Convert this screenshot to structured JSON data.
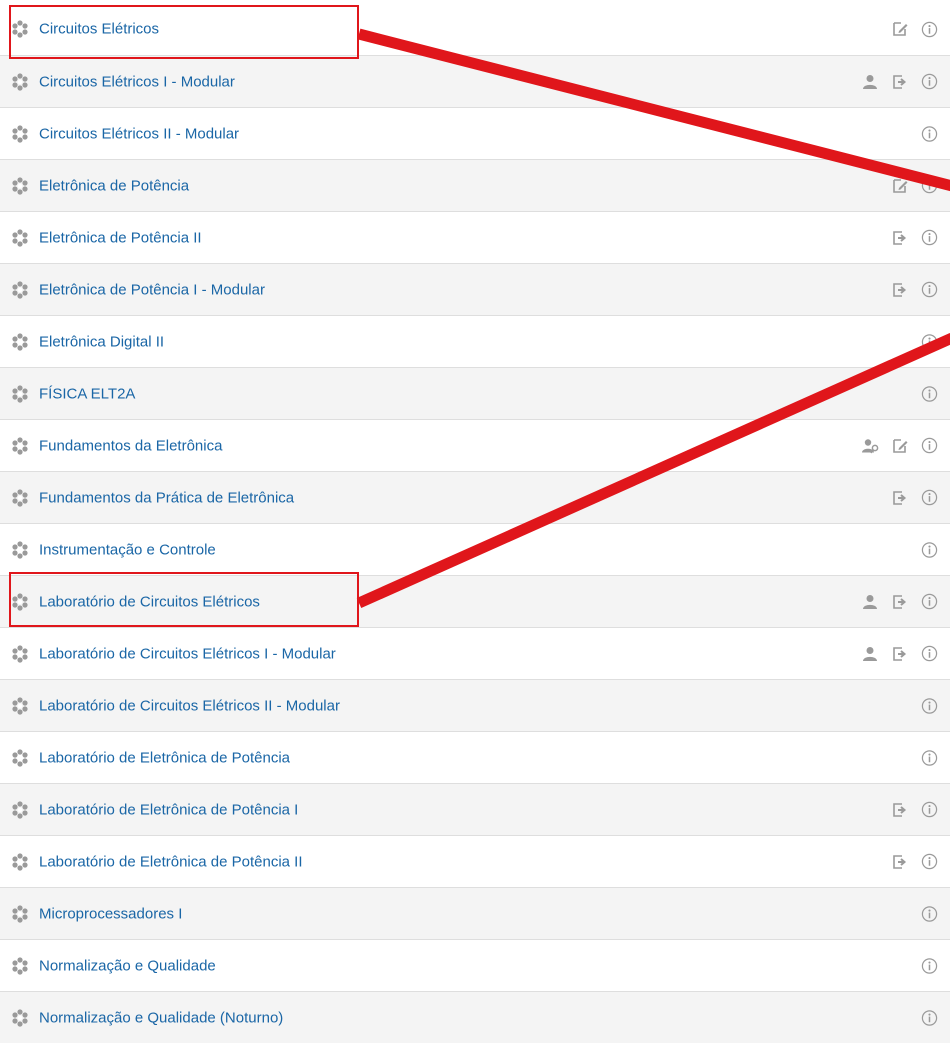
{
  "courses": [
    {
      "name": "Circuitos Elétricos",
      "actions": [
        "edit-icon"
      ],
      "highlighted": true
    },
    {
      "name": "Circuitos Elétricos I - Modular",
      "actions": [
        "user-icon",
        "enrol-icon"
      ]
    },
    {
      "name": "Circuitos Elétricos II - Modular",
      "actions": []
    },
    {
      "name": "Eletrônica de Potência",
      "actions": [
        "edit-icon"
      ]
    },
    {
      "name": "Eletrônica de Potência II",
      "actions": [
        "enrol-icon"
      ]
    },
    {
      "name": "Eletrônica de Potência I - Modular",
      "actions": [
        "enrol-icon"
      ]
    },
    {
      "name": "Eletrônica Digital II",
      "actions": []
    },
    {
      "name": "FÍSICA ELT2A",
      "actions": []
    },
    {
      "name": "Fundamentos da Eletrônica",
      "actions": [
        "guest-icon",
        "edit-icon"
      ]
    },
    {
      "name": "Fundamentos da Prática de Eletrônica",
      "actions": [
        "enrol-icon"
      ]
    },
    {
      "name": "Instrumentação e Controle",
      "actions": []
    },
    {
      "name": "Laboratório de Circuitos Elétricos",
      "actions": [
        "user-icon",
        "enrol-icon"
      ],
      "highlighted": true
    },
    {
      "name": "Laboratório de Circuitos Elétricos I - Modular",
      "actions": [
        "user-icon",
        "enrol-icon"
      ]
    },
    {
      "name": "Laboratório de Circuitos Elétricos II - Modular",
      "actions": []
    },
    {
      "name": "Laboratório de Eletrônica de Potência",
      "actions": []
    },
    {
      "name": "Laboratório de Eletrônica de Potência I",
      "actions": [
        "enrol-icon"
      ]
    },
    {
      "name": "Laboratório de Eletrônica de Potência II",
      "actions": [
        "enrol-icon"
      ]
    },
    {
      "name": "Microprocessadores I",
      "actions": []
    },
    {
      "name": "Normalização e Qualidade",
      "actions": []
    },
    {
      "name": "Normalização e Qualidade (Noturno)",
      "actions": []
    }
  ],
  "colors": {
    "link": "#1a66a6",
    "annotation": "#e0161b",
    "icon_gray": "#9a9a9a"
  }
}
